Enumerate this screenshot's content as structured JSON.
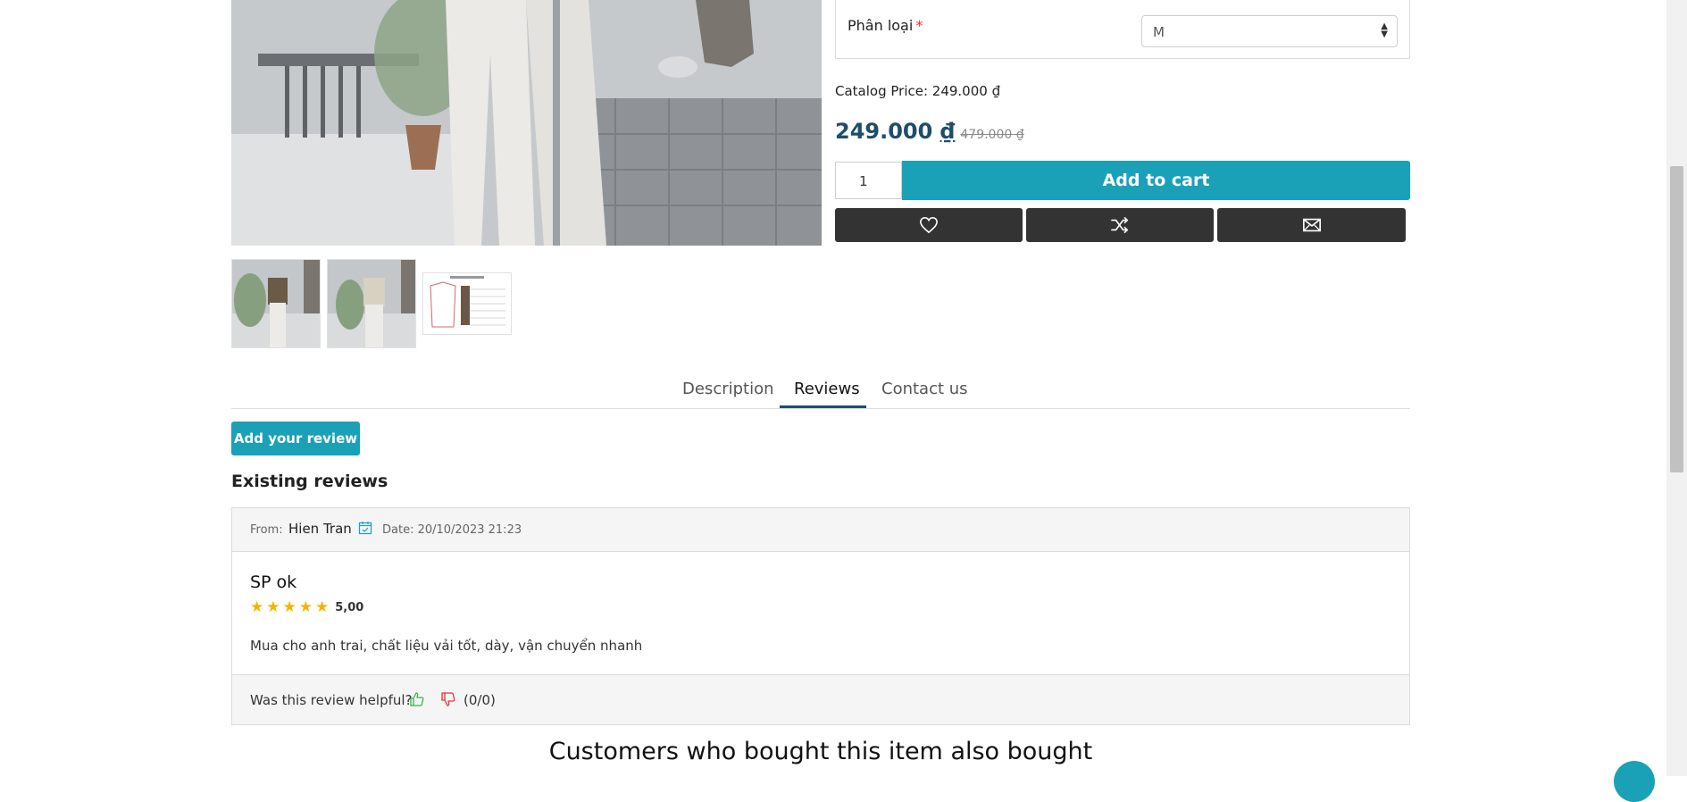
{
  "product_images": {
    "main_alt": "Main product photo",
    "thumbnails": [
      {
        "alt": "Thumbnail 1"
      },
      {
        "alt": "Thumbnail 2"
      },
      {
        "alt": "Size guide thumbnail"
      }
    ]
  },
  "attribute": {
    "label": "Phân loại",
    "required_mark": "*",
    "selected": "M"
  },
  "pricing": {
    "catalog_price": "Catalog Price: 249.000 ₫",
    "current_amount": "249.000",
    "currency": "₫",
    "old_price": "479.000 ₫"
  },
  "cart": {
    "quantity": "1",
    "add_to_cart_label": "Add to cart"
  },
  "actions": [
    {
      "icon": "heart-icon"
    },
    {
      "icon": "shuffle-icon"
    },
    {
      "icon": "envelope-icon"
    }
  ],
  "tabs": [
    {
      "label": "Description",
      "active": false
    },
    {
      "label": "Reviews",
      "active": true
    },
    {
      "label": "Contact us",
      "active": false
    }
  ],
  "reviews": {
    "add_review_label": "Add your review",
    "section_title": "Existing reviews",
    "items": [
      {
        "from_label": "From:",
        "author": "Hien Tran",
        "date": "Date: 20/10/2023 21:23",
        "title": "SP ok",
        "rating": 5,
        "rating_text": "5,00",
        "text": "Mua cho anh trai, chất liệu vải tốt, dày, vận chuyển nhanh",
        "helpful_question": "Was this review helpful?",
        "votes": "(0/0)"
      }
    ]
  },
  "also_bought_title": "Customers who bought this item also bought",
  "colors": {
    "accent": "#1aa1b8",
    "price": "#1d4e6b",
    "dark_button": "#333333",
    "star": "#f5b301",
    "thumb_up": "#3bb54a",
    "thumb_down": "#e3342f"
  }
}
